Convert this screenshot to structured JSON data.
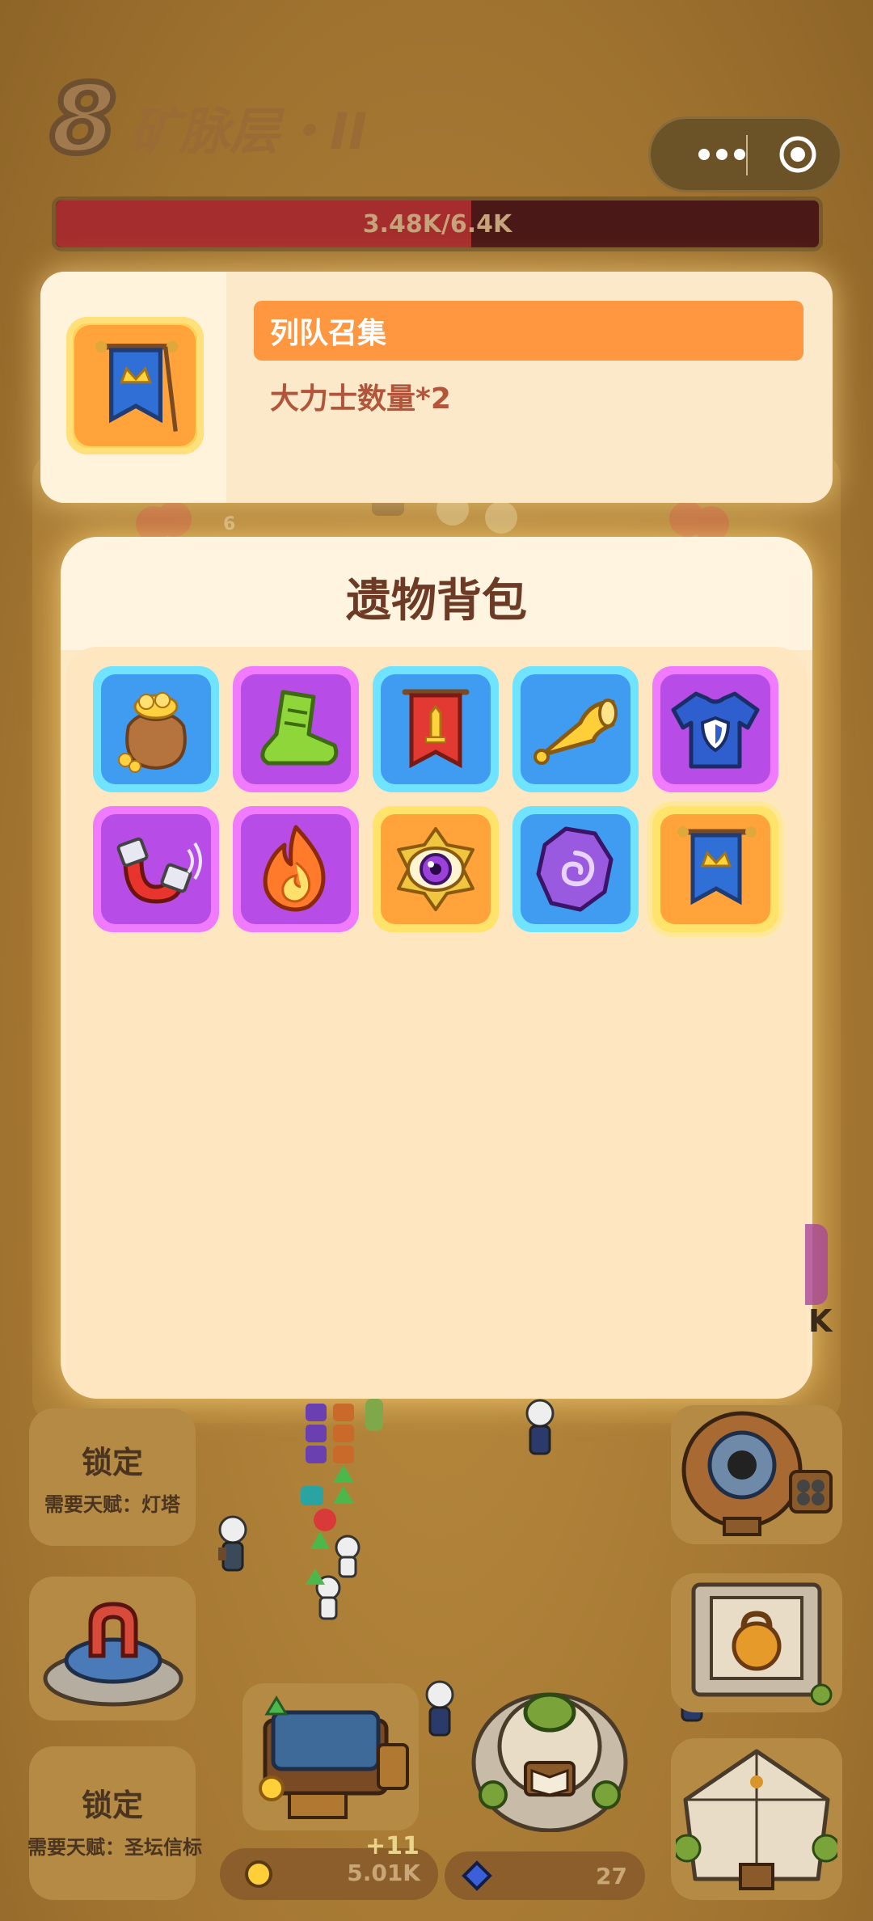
{
  "header": {
    "level_number": "8",
    "level_title": "矿脉层・II",
    "hp_text": "3.48K/6.4K",
    "hp_fraction": 0.544
  },
  "mini_program_capsule": {
    "more_icon": "more-dots-icon",
    "close_icon": "target-close-icon"
  },
  "relic_info": {
    "icon": "royal-banner-icon",
    "name": "列队召集",
    "description": "大力士数量*2"
  },
  "bag": {
    "title": "遗物背包",
    "items": [
      {
        "icon": "gold-coin-bag-icon",
        "rarity": "blue"
      },
      {
        "icon": "green-boot-icon",
        "rarity": "purple"
      },
      {
        "icon": "sword-banner-icon",
        "rarity": "blue"
      },
      {
        "icon": "golden-horn-icon",
        "rarity": "blue"
      },
      {
        "icon": "shield-shirt-icon",
        "rarity": "purple"
      },
      {
        "icon": "magnet-icon",
        "rarity": "purple"
      },
      {
        "icon": "fire-icon",
        "rarity": "purple"
      },
      {
        "icon": "purple-eye-icon",
        "rarity": "orange"
      },
      {
        "icon": "spiral-crystal-icon",
        "rarity": "blue"
      },
      {
        "icon": "royal-banner-icon",
        "rarity": "orange",
        "selected": true
      }
    ]
  },
  "background": {
    "lane_count_label": "6",
    "partial_value": "K",
    "locked_1": {
      "title": "锁定",
      "requirement": "需要天赋：灯塔"
    },
    "locked_2": {
      "title": "锁定",
      "requirement": "需要天赋：圣坛信标"
    },
    "gold": {
      "icon": "gold-coin-icon",
      "value": "5.01K"
    },
    "gems": {
      "icon": "blue-gem-icon",
      "value": "27"
    },
    "float_text": "+11"
  },
  "colors": {
    "background": "#a97f3a",
    "hp_fill": "#a62d2d",
    "name_bar": "#ff9640",
    "description": "#b2553a",
    "title": "#6d3a25"
  }
}
